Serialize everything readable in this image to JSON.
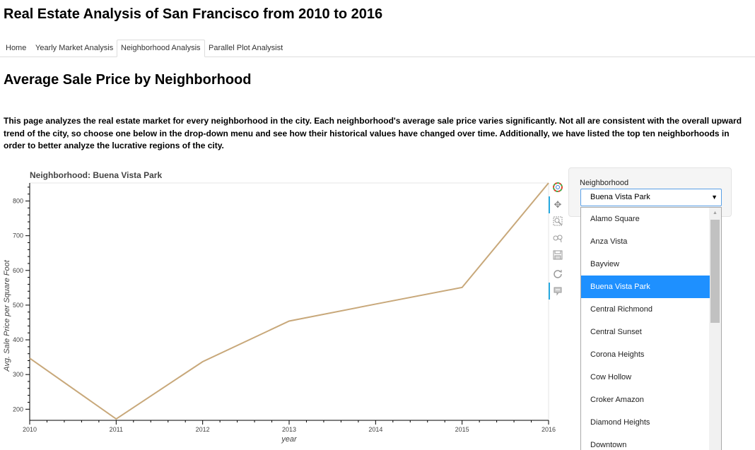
{
  "app_title": "Real Estate Analysis of San Francisco from 2010 to 2016",
  "tabs": [
    {
      "label": "Home",
      "active": false
    },
    {
      "label": "Yearly Market Analysis",
      "active": false
    },
    {
      "label": "Neighborhood Analysis",
      "active": true
    },
    {
      "label": "Parallel Plot Analysist",
      "active": false
    }
  ],
  "page_title": "Average Sale Price by Neighborhood",
  "intro": "This page analyzes the real estate market for every neighborhood in the city. Each neighborhood's average sale price varies significantly. Not all are consistent with the overall upward trend of the city, so choose one below in the drop-down menu and see how their historical values have changed over time. Additionally, we have listed the top ten neighborhoods in order to better analyze the lucrative regions of the city.",
  "toolbar": {
    "tools": [
      "bokeh-logo-icon",
      "pan-icon",
      "box-zoom-icon",
      "wheel-zoom-icon",
      "save-icon",
      "reset-icon",
      "hover-icon"
    ]
  },
  "widget": {
    "label": "Neighborhood",
    "selected": "Buena Vista Park",
    "options": [
      "Alamo Square",
      "Anza Vista",
      "Bayview",
      "Buena Vista Park",
      "Central Richmond",
      "Central Sunset",
      "Corona Heights",
      "Cow Hollow",
      "Croker Amazon",
      "Diamond Heights",
      "Downtown"
    ]
  },
  "chart_data": {
    "type": "line",
    "title": "Neighborhood: Buena Vista Park",
    "xlabel": "year",
    "ylabel": "Avg. Sale Price per Square Foot",
    "x": [
      2010,
      2011,
      2012,
      2013,
      2014,
      2015,
      2016
    ],
    "series": [
      {
        "values": [
          347,
          172,
          337,
          454,
          503,
          551,
          852
        ],
        "color": "#c8a87a"
      }
    ],
    "xlim": [
      2010,
      2016
    ],
    "ylim": [
      168,
      852
    ],
    "xticks": [
      2010,
      2011,
      2012,
      2013,
      2014,
      2015,
      2016
    ],
    "yticks": [
      200,
      300,
      400,
      500,
      600,
      700,
      800
    ],
    "grid": false
  }
}
